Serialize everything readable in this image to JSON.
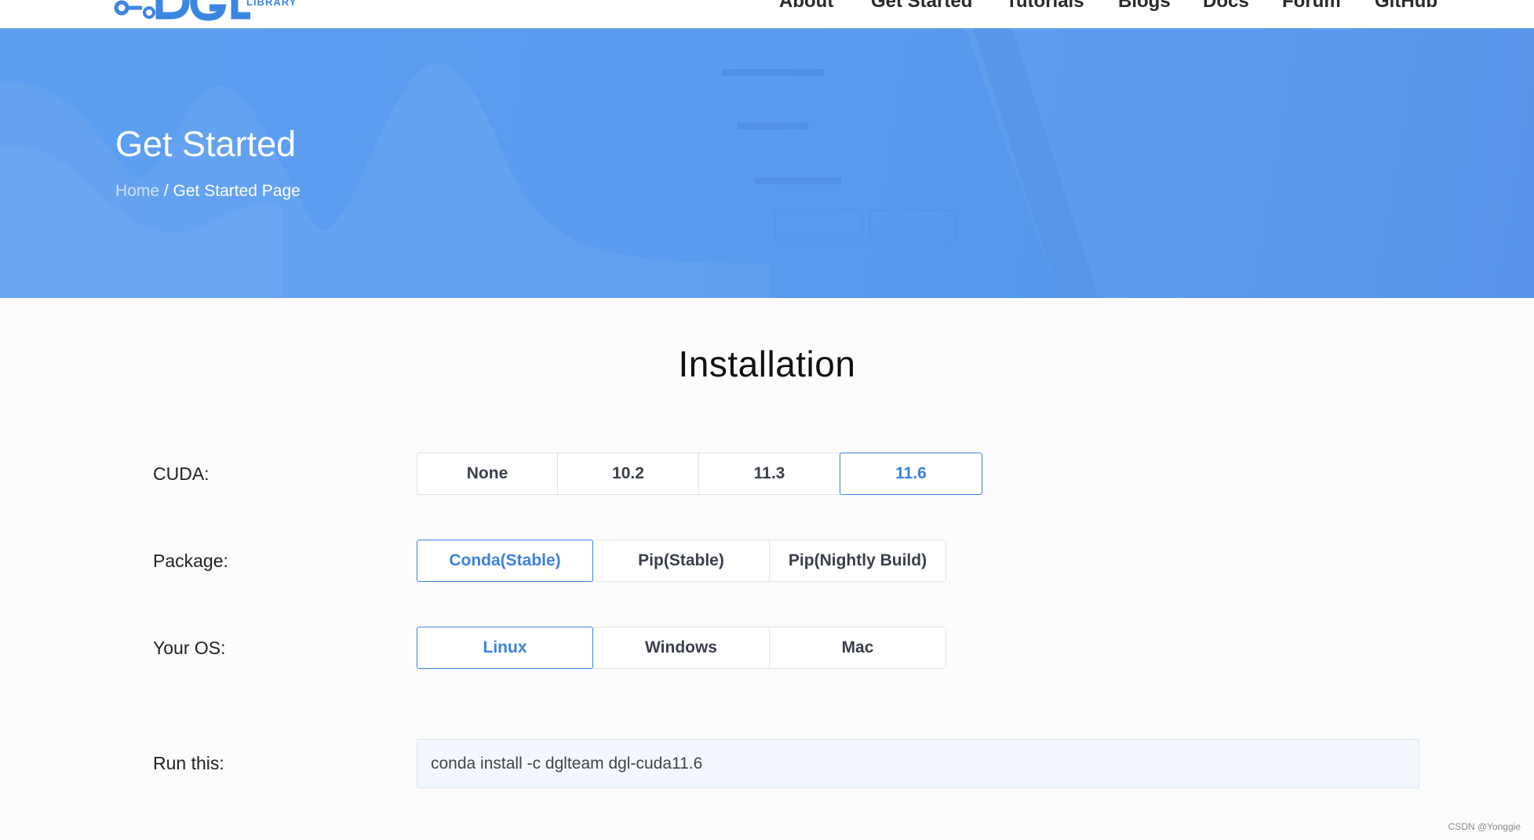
{
  "nav": {
    "logo_sub": "LIBRARY",
    "items": [
      "About",
      "Get Started",
      "Tutorials",
      "Blogs",
      "Docs",
      "Forum",
      "GitHub"
    ]
  },
  "hero": {
    "title": "Get Started",
    "breadcrumb_home": "Home",
    "breadcrumb_sep": " / ",
    "breadcrumb_current": "Get Started Page"
  },
  "install": {
    "title": "Installation",
    "cuda": {
      "label": "CUDA:",
      "options": [
        "None",
        "10.2",
        "11.3",
        "11.6"
      ],
      "selected": "11.6"
    },
    "package": {
      "label": "Package:",
      "options": [
        "Conda(Stable)",
        "Pip(Stable)",
        "Pip(Nightly Build)"
      ],
      "selected": "Conda(Stable)"
    },
    "os": {
      "label": "Your OS:",
      "options": [
        "Linux",
        "Windows",
        "Mac"
      ],
      "selected": "Linux"
    },
    "run_label": "Run this:",
    "command": "conda install -c dglteam dgl-cuda11.6"
  },
  "watermark": "CSDN @Yonggie",
  "colors": {
    "accent": "#3b82e0",
    "hero": "#5a9cef"
  }
}
